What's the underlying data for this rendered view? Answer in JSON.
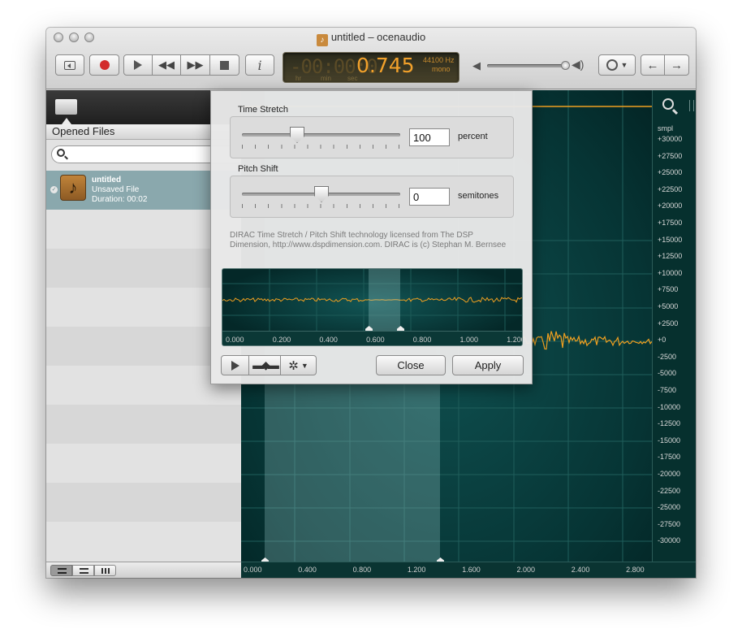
{
  "window": {
    "title": "untitled – ocenaudio"
  },
  "toolbar": {
    "lcd_dim": "-00:00:0",
    "lcd_value": "0.745",
    "sample_rate": "44100 Hz",
    "channels": "mono",
    "unit_hr": "hr",
    "unit_min": "min",
    "unit_sec": "sec",
    "info_label": "i",
    "volume_level": 0.95
  },
  "sidebar": {
    "header": "Opened Files",
    "search_placeholder": "",
    "files": [
      {
        "name": "untitled",
        "status": "Unsaved File",
        "duration": "Duration: 00:02"
      }
    ]
  },
  "ruler": {
    "unit": "smpl",
    "labels": [
      "+30000",
      "+27500",
      "+25000",
      "+22500",
      "+20000",
      "+17500",
      "+15000",
      "+12500",
      "+10000",
      "+7500",
      "+5000",
      "+2500",
      "+0",
      "-2500",
      "-5000",
      "-7500",
      "-10000",
      "-12500",
      "-15000",
      "-17500",
      "-20000",
      "-22500",
      "-25000",
      "-27500",
      "-30000"
    ]
  },
  "timeline": {
    "labels": [
      "0.000",
      "0.400",
      "0.800",
      "1.200",
      "1.600",
      "2.000",
      "2.400",
      "2.800"
    ]
  },
  "dialog": {
    "time_stretch_label": "Time Stretch",
    "time_stretch_value": "100",
    "time_stretch_unit": "percent",
    "pitch_shift_label": "Pitch Shift",
    "pitch_shift_value": "0",
    "pitch_shift_unit": "semitones",
    "credit": "DIRAC Time Stretch / Pitch Shift technology licensed from The DSP Dimension, http://www.dspdimension.com. DIRAC is (c) Stephan M. Bernsee",
    "mini_labels": [
      "0.000",
      "0.200",
      "0.400",
      "0.600",
      "0.800",
      "1.000",
      "1.200"
    ],
    "close_label": "Close",
    "apply_label": "Apply"
  },
  "colors": {
    "waveform": "#f0a020",
    "lcd_text": "#f2a12b",
    "wave_bg": "#063434",
    "selected_row": "#8aa8ad"
  }
}
